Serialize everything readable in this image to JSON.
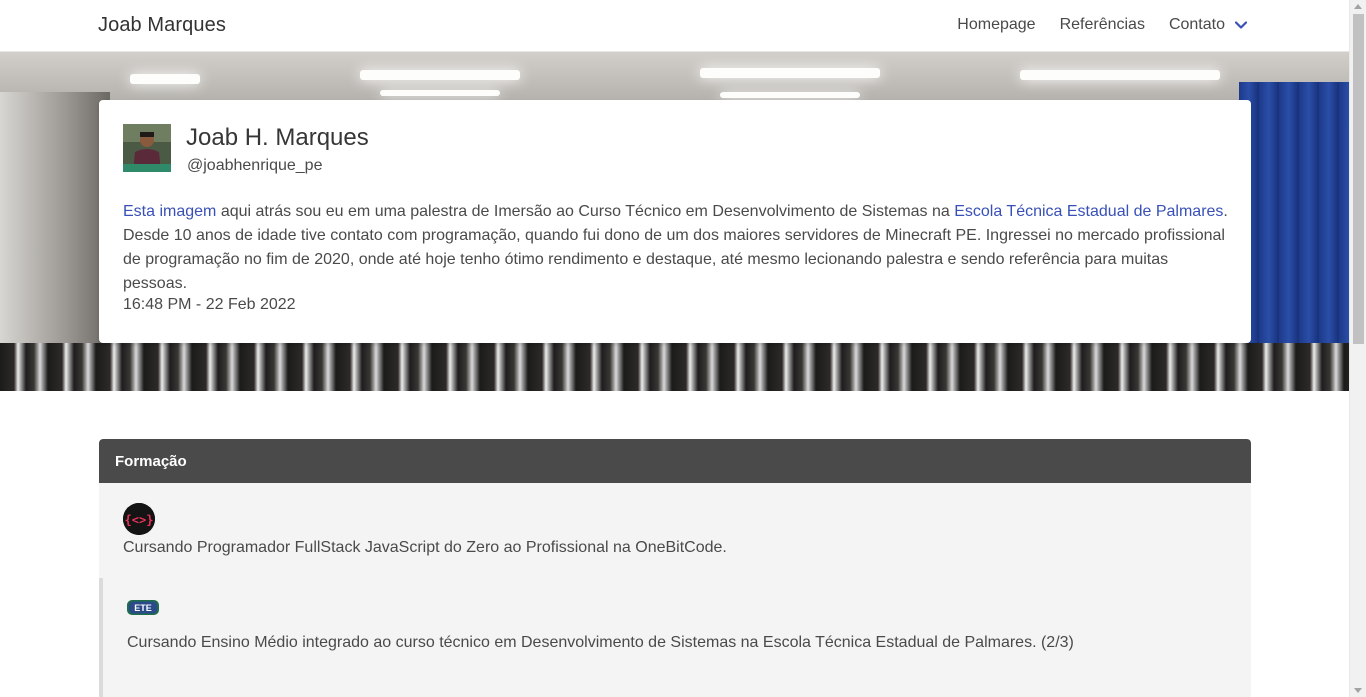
{
  "navbar": {
    "brand": "Joab Marques",
    "links": [
      "Homepage",
      "Referências",
      "Contato"
    ]
  },
  "profile": {
    "name": "Joab H. Marques",
    "handle": "@joabhenrique_pe",
    "bio_link1": "Esta imagem",
    "bio_part1": " aqui atrás sou eu em uma palestra de Imersão ao Curso Técnico em Desenvolvimento de Sistemas na ",
    "bio_link2": "Escola Técnica Estadual de Palmares",
    "bio_part2": ". Desde 10 anos de idade tive contato com programação, quando fui dono de um dos maiores servidores de Minecraft PE. Ingressei no mercado profissional de programação no fim de 2020, onde até hoje tenho ótimo rendimento e destaque, até mesmo lecionando palestra e sendo referência para muitas pessoas.",
    "timestamp": "16:48 PM - 22 Feb 2022"
  },
  "formacao": {
    "title": "Formação",
    "entries": [
      {
        "text": "Cursando Programador FullStack JavaScript do Zero ao Profissional na OneBitCode.",
        "icon": "onebitcode-logo"
      },
      {
        "text": "Cursando Ensino Médio integrado ao curso técnico em Desenvolvimento de Sistemas na Escola Técnica Estadual de Palmares. (2/3)",
        "icon": "ete-logo",
        "logo_text": "ETE"
      }
    ]
  },
  "icons": {
    "dropdown": "chevron-down-icon"
  },
  "colors": {
    "link": "#3850b7",
    "panel_header": "#4a4a4a",
    "panel_bg": "#f4f4f4"
  }
}
